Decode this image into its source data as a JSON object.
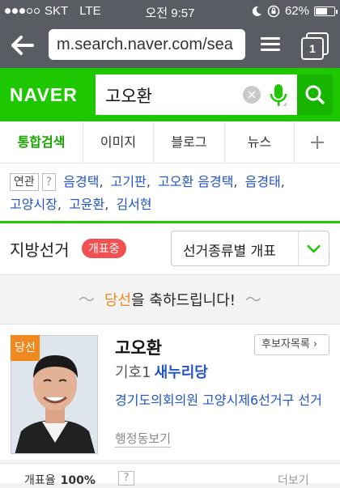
{
  "status": {
    "carrier": "SKT",
    "network": "LTE",
    "time": "오전 9:57",
    "battery": "62%",
    "battery_level": 0.62
  },
  "browser": {
    "url": "m.search.naver.com/sea",
    "tab_count": "1"
  },
  "naver": {
    "logo": "NAVER",
    "query": "고오환",
    "accent": "#1ec800"
  },
  "tabs": [
    "통합검색",
    "이미지",
    "블로그",
    "뉴스",
    "+"
  ],
  "related": {
    "label": "연관",
    "help": "?",
    "links": [
      "음경택",
      "고기판",
      "고오환 음경택",
      "음경태",
      "고양시장",
      "고윤환",
      "김서현"
    ]
  },
  "election": {
    "title": "지방선거",
    "badge": "개표중",
    "select_value": "선거종류별 개표"
  },
  "congrats": {
    "highlight": "당선",
    "rest": "을 축하드립니다!",
    "deco_left": "〜",
    "deco_right": "〜"
  },
  "candidate": {
    "won_label": "당선",
    "name": "고오환",
    "list_button": "후보자목록 ›",
    "number": "기호1",
    "party": "새누리당",
    "office": "경기도의회의원 고양시제6선거구 선거",
    "address_link": "행정동보기"
  },
  "bottom": {
    "label": "개표율",
    "percent": "100%",
    "help": "?",
    "more": "더보기"
  }
}
